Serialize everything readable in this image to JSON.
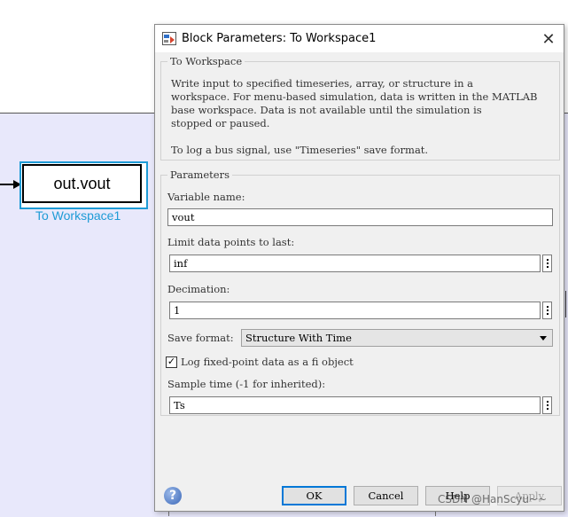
{
  "model": {
    "block_text": "out.vout",
    "block_label": "To Workspace1"
  },
  "dialog": {
    "title": "Block Parameters: To Workspace1",
    "close_glyph": "✕",
    "section_title": "To Workspace",
    "description_1": "Write input to specified timeseries, array, or structure in a\nworkspace. For menu-based simulation, data is written in the MATLAB\nbase workspace. Data is not available until the simulation is\nstopped or paused.",
    "description_2": "To log a bus signal, use \"Timeseries\" save format.",
    "parameters_title": "Parameters",
    "variable_name_label": "Variable name:",
    "variable_name_value": "vout",
    "limit_label": "Limit data points to last:",
    "limit_value": "inf",
    "decimation_label": "Decimation:",
    "decimation_value": "1",
    "save_format_label": "Save format:",
    "save_format_value": "Structure With Time",
    "log_fixed_point_label": "Log fixed-point data as a fi object",
    "log_fixed_point_checked": true,
    "log_fixed_point_mark": "✓",
    "sample_time_label": "Sample time (-1 for inherited):",
    "sample_time_value": "Ts",
    "help_glyph": "?",
    "buttons": {
      "ok": "OK",
      "cancel": "Cancel",
      "help": "Help",
      "apply": "Apply"
    }
  },
  "watermark": "CSDN @HanScyu~~",
  "icons": {
    "title_icon": "block-parameters-icon",
    "close": "close-icon",
    "help": "help-icon",
    "kebab": "more-options-icon",
    "dropdown": "chevron-down-icon",
    "checkbox": "checkmark-icon"
  }
}
